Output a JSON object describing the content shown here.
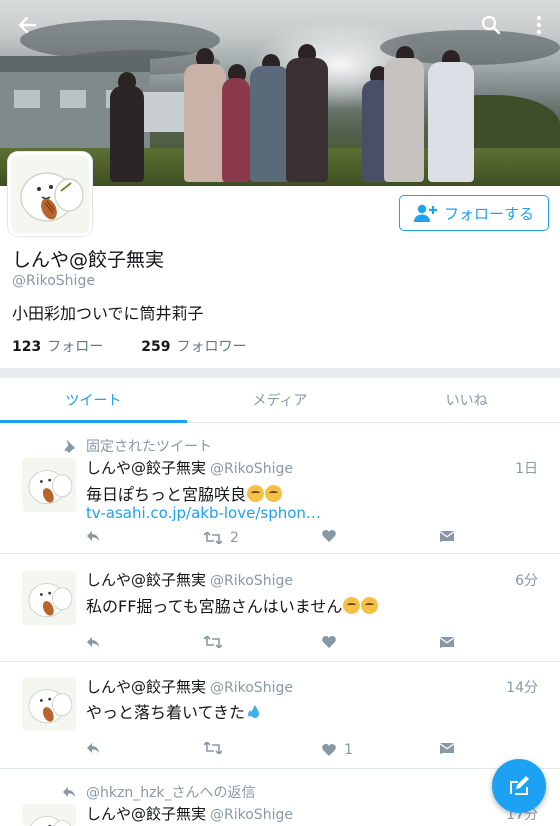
{
  "profile": {
    "name": "しんや@餃子無実",
    "handle": "@RikoShige",
    "bio": "小田彩加ついでに筒井莉子",
    "following_count": "123",
    "following_label": "フォロー",
    "followers_count": "259",
    "followers_label": "フォロワー",
    "follow_button_label": "フォローする"
  },
  "tabs": [
    {
      "label": "ツイート",
      "active": true
    },
    {
      "label": "メディア",
      "active": false
    },
    {
      "label": "いいね",
      "active": false
    }
  ],
  "tweets": [
    {
      "context": "固定されたツイート",
      "name": "しんや@餃子無実",
      "handle": "@RikoShige",
      "time": "1日",
      "text": "毎日ぽちっと宮脇咲良",
      "link": "tv-asahi.co.jp/akb-love/sphon…",
      "retweets": "2",
      "likes": ""
    },
    {
      "context": "",
      "name": "しんや@餃子無実",
      "handle": "@RikoShige",
      "time": "6分",
      "text": "私のFF掘っても宮脇さんはいません",
      "retweets": "",
      "likes": ""
    },
    {
      "context": "",
      "name": "しんや@餃子無実",
      "handle": "@RikoShige",
      "time": "14分",
      "text": "やっと落ち着いてきた",
      "retweets": "",
      "likes": "1"
    },
    {
      "context": "@hkzn_hzk_さんへの返信",
      "name": "しんや@餃子無実",
      "handle": "@RikoShige",
      "time": "17分",
      "text": ""
    }
  ],
  "colors": {
    "accent": "#1da1f2",
    "muted": "#8899a6",
    "text": "#14171a"
  }
}
